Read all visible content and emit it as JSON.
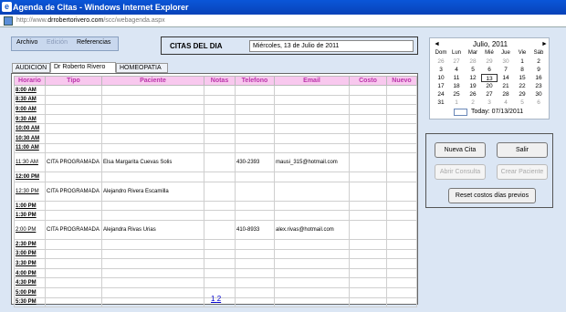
{
  "window": {
    "title": "Agenda de Citas - Windows Internet Explorer",
    "address_prefix": "http://www.",
    "address_domain": "drrobertorivero.com",
    "address_suffix": "/scc/webagenda.aspx"
  },
  "menu": {
    "archivo": "Archivo",
    "edicion": "Edición",
    "referencias": "Referencias"
  },
  "header": {
    "citas_label": "CITAS DEL DIA",
    "date_value": "Miércoles, 13 de Julio de 2011"
  },
  "tabs": [
    "AUDICION",
    "Dr Roberto Rivero",
    "HOMEOPATIA"
  ],
  "table": {
    "columns": [
      "Horario",
      "Tipo",
      "Paciente",
      "Notas",
      "Telefono",
      "Email",
      "Costo",
      "Nuevo"
    ],
    "rows": [
      {
        "time": "8:00 AM",
        "tipo": "",
        "paciente": "",
        "notas": "",
        "tel": "",
        "email": "",
        "costo": "",
        "nuevo": ""
      },
      {
        "time": "8:30 AM",
        "tipo": "",
        "paciente": "",
        "notas": "",
        "tel": "",
        "email": "",
        "costo": "",
        "nuevo": ""
      },
      {
        "time": "9:00 AM",
        "tipo": "",
        "paciente": "",
        "notas": "",
        "tel": "",
        "email": "",
        "costo": "",
        "nuevo": ""
      },
      {
        "time": "9:30 AM",
        "tipo": "",
        "paciente": "",
        "notas": "",
        "tel": "",
        "email": "",
        "costo": "",
        "nuevo": ""
      },
      {
        "time": "10:00 AM",
        "tipo": "",
        "paciente": "",
        "notas": "",
        "tel": "",
        "email": "",
        "costo": "",
        "nuevo": ""
      },
      {
        "time": "10:30 AM",
        "tipo": "",
        "paciente": "",
        "notas": "",
        "tel": "",
        "email": "",
        "costo": "",
        "nuevo": ""
      },
      {
        "time": "11:00 AM",
        "tipo": "",
        "paciente": "",
        "notas": "",
        "tel": "",
        "email": "",
        "costo": "",
        "nuevo": ""
      },
      {
        "time": "11:30 AM",
        "tipo": "CITA PROGRAMADA",
        "paciente": "Elsa Margarita Cuevas Solis",
        "notas": "",
        "tel": "430-2393",
        "email": "mausi_315@hotmail.com",
        "costo": "",
        "nuevo": ""
      },
      {
        "time": "12:00 PM",
        "tipo": "",
        "paciente": "",
        "notas": "",
        "tel": "",
        "email": "",
        "costo": "",
        "nuevo": ""
      },
      {
        "time": "12:30 PM",
        "tipo": "CITA PROGRAMADA",
        "paciente": "Alejandro Rivera Escamilla",
        "notas": "",
        "tel": "",
        "email": "",
        "costo": "",
        "nuevo": ""
      },
      {
        "time": "1:00 PM",
        "tipo": "",
        "paciente": "",
        "notas": "",
        "tel": "",
        "email": "",
        "costo": "",
        "nuevo": ""
      },
      {
        "time": "1:30 PM",
        "tipo": "",
        "paciente": "",
        "notas": "",
        "tel": "",
        "email": "",
        "costo": "",
        "nuevo": ""
      },
      {
        "time": "2:00 PM",
        "tipo": "CITA PROGRAMADA",
        "paciente": "Alejandra Rivas Urias",
        "notas": "",
        "tel": "410-8933",
        "email": "alex.rivas@hotmail.com",
        "costo": "",
        "nuevo": ""
      },
      {
        "time": "2:30 PM",
        "tipo": "",
        "paciente": "",
        "notas": "",
        "tel": "",
        "email": "",
        "costo": "",
        "nuevo": ""
      },
      {
        "time": "3:00 PM",
        "tipo": "",
        "paciente": "",
        "notas": "",
        "tel": "",
        "email": "",
        "costo": "",
        "nuevo": ""
      },
      {
        "time": "3:30 PM",
        "tipo": "",
        "paciente": "",
        "notas": "",
        "tel": "",
        "email": "",
        "costo": "",
        "nuevo": ""
      },
      {
        "time": "4:00 PM",
        "tipo": "",
        "paciente": "",
        "notas": "",
        "tel": "",
        "email": "",
        "costo": "",
        "nuevo": ""
      },
      {
        "time": "4:30 PM",
        "tipo": "",
        "paciente": "",
        "notas": "",
        "tel": "",
        "email": "",
        "costo": "",
        "nuevo": ""
      },
      {
        "time": "5:00 PM",
        "tipo": "",
        "paciente": "",
        "notas": "",
        "tel": "",
        "email": "",
        "costo": "",
        "nuevo": ""
      },
      {
        "time": "5:30 PM",
        "tipo": "",
        "paciente": "",
        "notas": "",
        "tel": "",
        "email": "",
        "costo": "",
        "nuevo": ""
      }
    ]
  },
  "pagination": {
    "page1": "1",
    "page2": "2"
  },
  "calendar": {
    "month": "Julio, 2011",
    "prev": "◄",
    "next": "►",
    "dows": [
      "Dom",
      "Lun",
      "Mar",
      "Mié",
      "Jue",
      "Vie",
      "Sáb"
    ],
    "weeks": [
      [
        "26",
        "27",
        "28",
        "29",
        "30",
        "1",
        "2"
      ],
      [
        "3",
        "4",
        "5",
        "6",
        "7",
        "8",
        "9"
      ],
      [
        "10",
        "11",
        "12",
        "13",
        "14",
        "15",
        "16"
      ],
      [
        "17",
        "18",
        "19",
        "20",
        "21",
        "22",
        "23"
      ],
      [
        "24",
        "25",
        "26",
        "27",
        "28",
        "29",
        "30"
      ],
      [
        "31",
        "1",
        "2",
        "3",
        "4",
        "5",
        "6"
      ]
    ],
    "selected": "13",
    "today_label": "Today: 07/13/2011"
  },
  "actions": {
    "nueva_cita": "Nueva Cita",
    "salir": "Salir",
    "abrir_consulta": "Abrir Consulta",
    "crear_paciente": "Crear Paciente",
    "reset": "Reset costos días previos"
  },
  "colors": {
    "header_bg": "#f8c8ee",
    "header_text": "#bb33aa",
    "title_bar": "#0a56d8",
    "page_bg": "#dbe6f4"
  }
}
